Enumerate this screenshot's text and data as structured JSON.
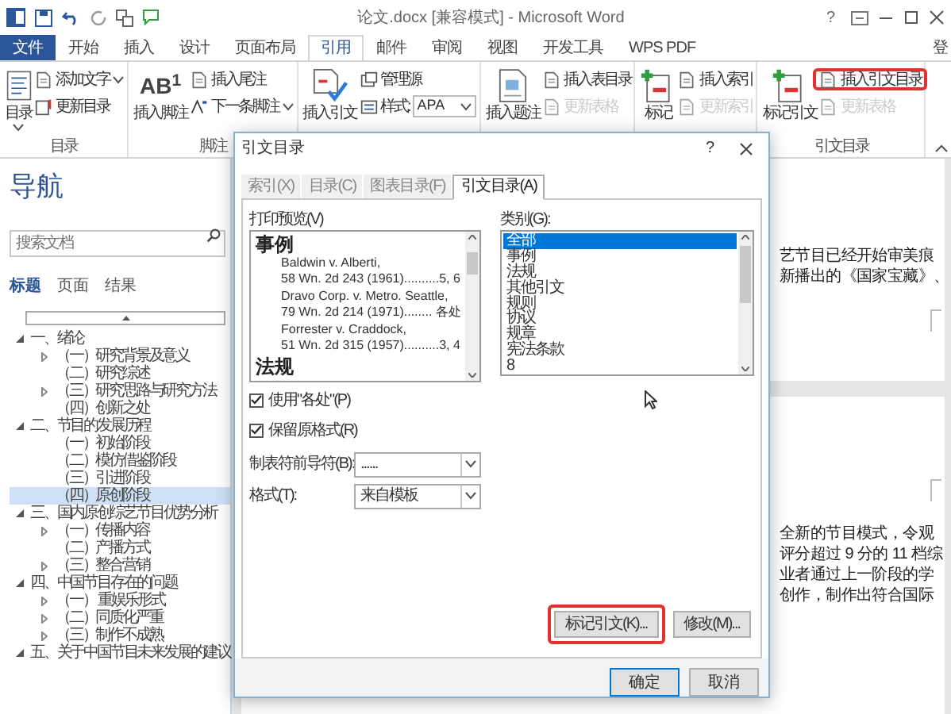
{
  "window": {
    "title": "论文.docx [兼容模式] - Microsoft Word",
    "help": "?"
  },
  "ribbon": {
    "file_tab": "文件",
    "sign_in": "登",
    "tabs": [
      {
        "label": "开始",
        "selected": false
      },
      {
        "label": "插入",
        "selected": false
      },
      {
        "label": "设计",
        "selected": false
      },
      {
        "label": "页面布局",
        "selected": false
      },
      {
        "label": "引用",
        "selected": true
      },
      {
        "label": "邮件",
        "selected": false
      },
      {
        "label": "审阅",
        "selected": false
      },
      {
        "label": "视图",
        "selected": false
      },
      {
        "label": "开发工具",
        "selected": false
      },
      {
        "label": "WPS PDF",
        "selected": false
      }
    ],
    "groups": [
      {
        "label": "目录",
        "large": {
          "label": "目录"
        },
        "items": [
          {
            "kind": "button",
            "label": "添加文字",
            "menu": true,
            "disabled": false,
            "highlighted": false
          },
          {
            "kind": "button",
            "label": "更新目录",
            "menu": false,
            "disabled": false,
            "highlighted": false
          }
        ]
      },
      {
        "label": "脚注",
        "large": {
          "label": "插入脚注",
          "icon_text": "AB$^{1}$"
        },
        "items": [
          {
            "kind": "button",
            "label": "插入尾注",
            "menu": false,
            "disabled": false,
            "highlighted": false
          },
          {
            "kind": "button",
            "label": "下一条脚注",
            "menu": true,
            "disabled": false,
            "highlighted": false
          }
        ]
      },
      {
        "large": {
          "label": "插入引文"
        },
        "items": [
          {
            "kind": "button",
            "label": "管理源",
            "menu": false,
            "disabled": false,
            "highlighted": false
          },
          {
            "kind": "select",
            "label": "样式:",
            "value": "APA",
            "menu": true
          }
        ]
      },
      {
        "large": {
          "label": "插入题注"
        },
        "items": [
          {
            "kind": "button",
            "label": "插入表目录",
            "menu": false,
            "disabled": false,
            "highlighted": false
          },
          {
            "kind": "button",
            "label": "更新表格",
            "menu": false,
            "disabled": true,
            "highlighted": false
          }
        ]
      },
      {
        "large": {
          "label": "标记"
        },
        "items": [
          {
            "kind": "button",
            "label": "插入索引",
            "menu": false,
            "disabled": false,
            "highlighted": false
          },
          {
            "kind": "button",
            "label": "更新索引",
            "menu": false,
            "disabled": true,
            "highlighted": false
          }
        ]
      },
      {
        "label": "引文目录",
        "large": {
          "label": "标记引文"
        },
        "items": [
          {
            "kind": "button",
            "label": "插入引文目录",
            "menu": false,
            "disabled": false,
            "highlighted": true
          },
          {
            "kind": "button",
            "label": "更新表格",
            "menu": false,
            "disabled": true,
            "highlighted": false
          }
        ]
      }
    ]
  },
  "navigation": {
    "title": "导航",
    "search": {
      "placeholder": "搜索文档"
    },
    "tabs": [
      {
        "label": "标题",
        "selected": true
      },
      {
        "label": "页面",
        "selected": false
      },
      {
        "label": "结果",
        "selected": false
      }
    ],
    "tree": [
      {
        "label": "一、绪论",
        "expanded": true,
        "selected": false,
        "children": [
          {
            "label": "（一）研究背景及意义",
            "expanded": false,
            "selected": false
          },
          {
            "label": "（二）研究综述",
            "selected": false
          },
          {
            "label": "（三）研究思路与研究方法",
            "expanded": false,
            "selected": false
          },
          {
            "label": "（四）创新之处",
            "selected": false
          }
        ]
      },
      {
        "label": "二、节目的发展历程",
        "expanded": true,
        "selected": false,
        "children": [
          {
            "label": "（一）初始阶段",
            "selected": false
          },
          {
            "label": "（二）模仿借鉴阶段",
            "selected": false
          },
          {
            "label": "（三）引进阶段",
            "selected": false
          },
          {
            "label": "（四）原创阶段",
            "selected": true
          }
        ]
      },
      {
        "label": "三、国内原创综艺节目优势分析",
        "expanded": true,
        "selected": false,
        "children": [
          {
            "label": "（一）传播内容",
            "expanded": false,
            "selected": false
          },
          {
            "label": "（二）产播方式",
            "selected": false
          },
          {
            "label": "（三）整合营销",
            "expanded": false,
            "selected": false
          }
        ]
      },
      {
        "label": "四、中国节目存在的问题",
        "expanded": true,
        "selected": false,
        "children": [
          {
            "label": "（一） 重娱乐形式",
            "expanded": false,
            "selected": false
          },
          {
            "label": "（二）同质化严重",
            "expanded": false,
            "selected": false
          },
          {
            "label": "（三）制作不成熟",
            "expanded": false,
            "selected": false
          }
        ]
      },
      {
        "label": "五、关于中国节目未来发展的建议",
        "expanded": true,
        "selected": false
      }
    ]
  },
  "document": {
    "pages": [
      {
        "lines": [
          "艺节目已经开始审美痕",
          "新播出的《国家宝藏》、"
        ]
      },
      {
        "lines": [
          "全新的节目模式，令观",
          "评分超过 9 分的 11 档综",
          "业者通过上一阶段的学",
          "创作，制作出符合国际"
        ]
      }
    ]
  },
  "dialog": {
    "title": "引文目录",
    "help": "?",
    "tabs": [
      {
        "label": "索引(X)",
        "selected": false
      },
      {
        "label": "目录(C)",
        "selected": false
      },
      {
        "label": "图表目录(F)",
        "selected": false
      },
      {
        "label": "引文目录(A)",
        "selected": true
      }
    ],
    "preview": {
      "label": "打印预览(V)",
      "lines": [
        {
          "kind": "heading",
          "text": "事例"
        },
        {
          "kind": "entry",
          "text": "Baldwin v. Alberti,"
        },
        {
          "kind": "entry",
          "text": "58 Wn. 2d 243 (1961)..........5, 6"
        },
        {
          "kind": "entry",
          "text": "Dravo Corp. v. Metro. Seattle,"
        },
        {
          "kind": "entry",
          "text": "79 Wn. 2d 214 (1971)........ 各处"
        },
        {
          "kind": "entry",
          "text": "Forrester v. Craddock,"
        },
        {
          "kind": "entry",
          "text": "51 Wn. 2d 315 (1957)..........3, 4"
        },
        {
          "kind": "heading",
          "text": "法规"
        }
      ]
    },
    "category": {
      "label": "类别(G):",
      "options": [
        {
          "label": "全部",
          "selected": true
        },
        {
          "label": "事例",
          "selected": false
        },
        {
          "label": "法规",
          "selected": false
        },
        {
          "label": "其他引文",
          "selected": false
        },
        {
          "label": "规则",
          "selected": false
        },
        {
          "label": "协议",
          "selected": false
        },
        {
          "label": "规章",
          "selected": false
        },
        {
          "label": "宪法条款",
          "selected": false
        },
        {
          "label": "8",
          "selected": false
        }
      ]
    },
    "options": [
      {
        "label": "使用\"各处\"(P)",
        "checked": true
      },
      {
        "label": "保留原格式(R)",
        "checked": true
      }
    ],
    "selects": [
      {
        "label": "制表符前导符(B):",
        "value": "......"
      },
      {
        "label": "格式(T):",
        "value": "来自模板"
      }
    ],
    "buttons": [
      {
        "label": "标记引文(K)...",
        "highlighted": true
      },
      {
        "label": "修改(M)...",
        "highlighted": false
      }
    ],
    "footer_buttons": [
      {
        "label": "确定",
        "default": true
      },
      {
        "label": "取消",
        "default": false
      }
    ]
  }
}
